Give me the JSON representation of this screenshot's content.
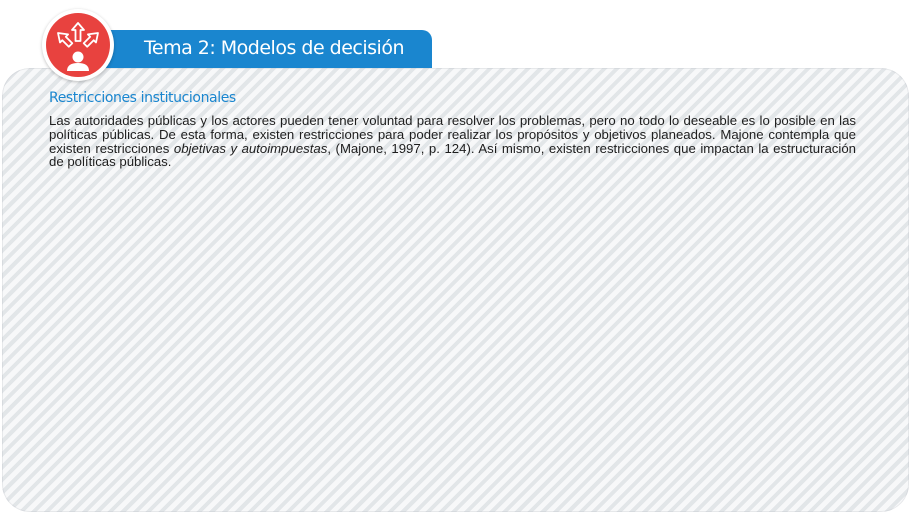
{
  "header": {
    "title": "Tema 2:  Modelos de decisión",
    "badge_icon": "person-with-outward-arrows-icon",
    "badge_color": "#e8423f",
    "bar_color": "#1a86cf"
  },
  "section": {
    "heading": "Restricciones institucionales",
    "paragraph": {
      "before_italic": "Las autoridades públicas y los actores pueden tener voluntad para resolver los problemas, pero no todo lo deseable es lo posible en las políticas públicas. De esta forma, existen restricciones para poder realizar los propósitos y objetivos planeados. Majone contempla que existen restricciones ",
      "italic": "objetivas y autoimpuestas",
      "after_italic": ", (Majone, 1997, p. 124). Así mismo, existen restricciones que impactan la estructuración de políticas públicas."
    }
  }
}
